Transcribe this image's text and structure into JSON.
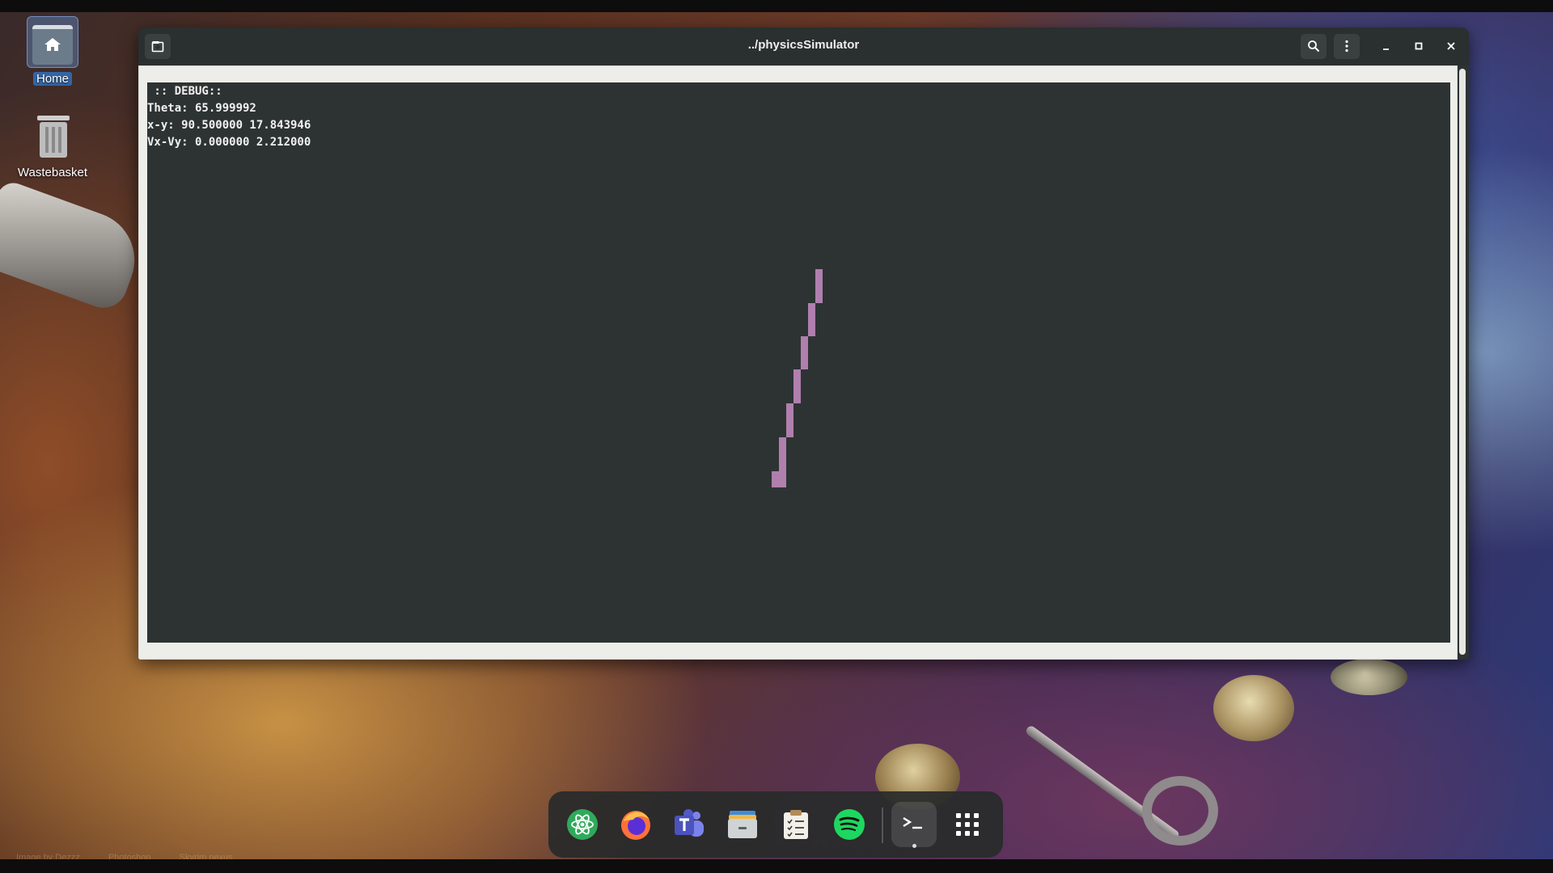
{
  "desktop": {
    "icons": [
      {
        "label": "Home",
        "icon": "home-folder-icon"
      },
      {
        "label": "Wastebasket",
        "icon": "trash-icon"
      }
    ],
    "credits": [
      "Image by Dezzz",
      "Photoshop",
      "Skyrim nexus"
    ]
  },
  "window": {
    "title": "../physicsSimulator",
    "buttons": [
      "new-tab-icon",
      "search-icon",
      "menu-icon",
      "minimize-icon",
      "maximize-icon",
      "close-icon"
    ]
  },
  "terminal": {
    "lines": [
      " :: DEBUG::",
      "Theta: 65.999992",
      "x-y: 90.500000 17.843946",
      "Vx-Vy: 0.000000 2.212000"
    ]
  },
  "simulation": {
    "color": "#b07fae",
    "stroke_color": "#a06aa0"
  },
  "dock": {
    "apps": [
      "atom-icon",
      "firefox-icon",
      "teams-icon",
      "files-icon",
      "todo-icon",
      "spotify-icon",
      "terminal-icon",
      "app-grid-icon"
    ],
    "active": "terminal-icon"
  },
  "colors": {
    "terminal_bg": "#2d3333",
    "selection": "#3465a4"
  }
}
